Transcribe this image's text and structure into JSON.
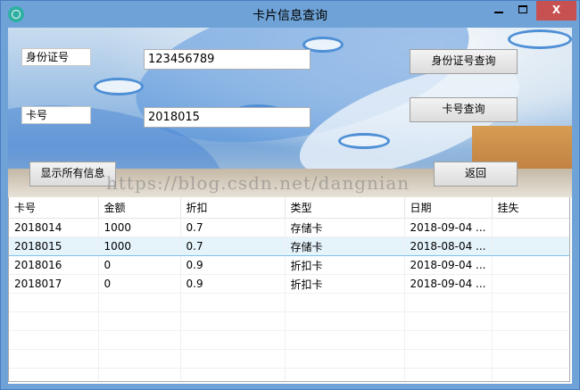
{
  "window": {
    "title": "卡片信息查询",
    "close_glyph": "X"
  },
  "form": {
    "id_label": "身份证号",
    "id_value": "123456789",
    "card_label": "卡号",
    "card_value": "2018015",
    "btn_id_query": "身份证号查询",
    "btn_card_query": "卡号查询",
    "btn_show_all": "显示所有信息",
    "btn_back": "返回"
  },
  "watermark": "https://blog.csdn.net/dangnian",
  "table": {
    "columns": [
      "卡号",
      "金额",
      "折扣",
      "类型",
      "日期",
      "挂失"
    ],
    "rows": [
      [
        "2018014",
        "1000",
        "0.7",
        "存储卡",
        "2018-09-04 ...",
        ""
      ],
      [
        "2018015",
        "1000",
        "0.7",
        "存储卡",
        "2018-08-04 ...",
        ""
      ],
      [
        "2018016",
        "0",
        "0.9",
        "折扣卡",
        "2018-09-04 ...",
        ""
      ],
      [
        "2018017",
        "0",
        "0.9",
        "折扣卡",
        "2018-09-04 ...",
        ""
      ]
    ],
    "selected_row": 1
  },
  "colors": {
    "titlebar": "#6fa3d8",
    "close": "#c75050",
    "selection": "#e5f3fb"
  }
}
